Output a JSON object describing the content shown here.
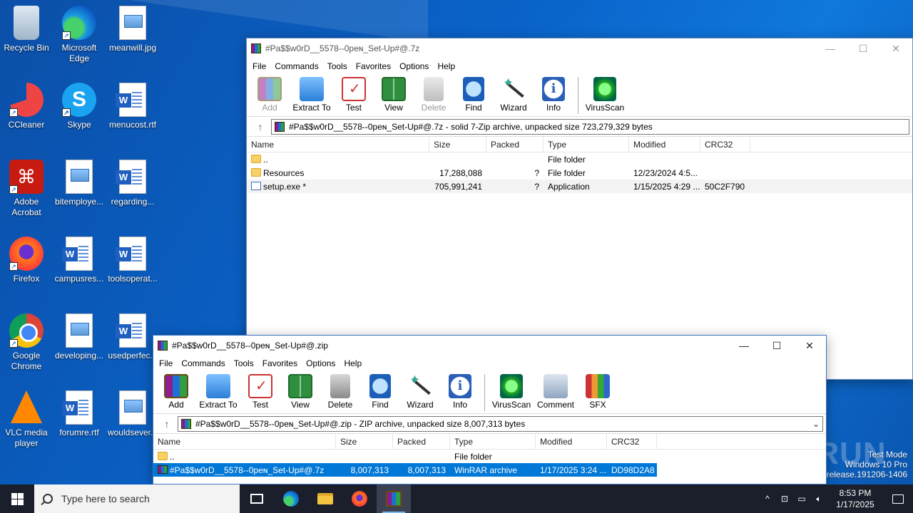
{
  "desktop": {
    "icons": [
      {
        "label": "Recycle Bin",
        "icon": "recycle-bin-icon"
      },
      {
        "label": "Microsoft Edge",
        "icon": "edge-icon"
      },
      {
        "label": "meanwill.jpg",
        "icon": "image-file-icon"
      },
      {
        "label": "CCleaner",
        "icon": "ccleaner-icon"
      },
      {
        "label": "Skype",
        "icon": "skype-icon"
      },
      {
        "label": "menucost.rtf",
        "icon": "word-doc-icon"
      },
      {
        "label": "Adobe Acrobat",
        "icon": "acrobat-icon"
      },
      {
        "label": "bitemploye...",
        "icon": "image-file-icon"
      },
      {
        "label": "regarding...",
        "icon": "word-doc-icon"
      },
      {
        "label": "Firefox",
        "icon": "firefox-icon"
      },
      {
        "label": "campusres...",
        "icon": "word-doc-icon"
      },
      {
        "label": "toolsoperat...",
        "icon": "word-doc-icon"
      },
      {
        "label": "Google Chrome",
        "icon": "chrome-icon"
      },
      {
        "label": "developing...",
        "icon": "image-file-icon"
      },
      {
        "label": "usedperfec...",
        "icon": "word-doc-icon"
      },
      {
        "label": "VLC media player",
        "icon": "vlc-icon"
      },
      {
        "label": "forumre.rtf",
        "icon": "word-doc-icon"
      },
      {
        "label": "wouldsever...",
        "icon": "image-file-icon"
      }
    ],
    "watermark": "ANY RUN",
    "os_info": {
      "line1": "Test Mode",
      "line2": "Windows 10 Pro",
      "line3": "b_release.191206-1406"
    }
  },
  "window_7z": {
    "title": "#Pa$$w0rD__5578--0peɴ_Set-Up#@.7z",
    "menu": [
      "File",
      "Commands",
      "Tools",
      "Favorites",
      "Options",
      "Help"
    ],
    "toolbar": [
      {
        "label": "Add",
        "icon": "add-archive-icon",
        "disabled": true
      },
      {
        "label": "Extract To",
        "icon": "extract-to-icon"
      },
      {
        "label": "Test",
        "icon": "test-icon"
      },
      {
        "label": "View",
        "icon": "view-icon"
      },
      {
        "label": "Delete",
        "icon": "delete-icon",
        "disabled": true
      },
      {
        "label": "Find",
        "icon": "find-icon"
      },
      {
        "label": "Wizard",
        "icon": "wizard-icon"
      },
      {
        "label": "Info",
        "icon": "info-icon"
      },
      {
        "label": "VirusScan",
        "icon": "virusscan-icon"
      }
    ],
    "address": "#Pa$$w0rD__5578--0peɴ_Set-Up#@.7z - solid 7-Zip archive, unpacked size 723,279,329 bytes",
    "columns": [
      "Name",
      "Size",
      "Packed",
      "Type",
      "Modified",
      "CRC32"
    ],
    "rows": [
      {
        "name": "..",
        "size": "",
        "packed": "",
        "type": "File folder",
        "modified": "",
        "crc": "",
        "kind": "folder"
      },
      {
        "name": "Resources",
        "size": "17,288,088",
        "packed": "?",
        "type": "File folder",
        "modified": "12/23/2024 4:5...",
        "crc": "",
        "kind": "folder"
      },
      {
        "name": "setup.exe *",
        "size": "705,991,241",
        "packed": "?",
        "type": "Application",
        "modified": "1/15/2025 4:29 ...",
        "crc": "50C2F790",
        "kind": "exe"
      }
    ]
  },
  "window_zip": {
    "title": "#Pa$$w0rD__5578--0peɴ_Set-Up#@.zip",
    "menu": [
      "File",
      "Commands",
      "Tools",
      "Favorites",
      "Options",
      "Help"
    ],
    "toolbar": [
      {
        "label": "Add",
        "icon": "add-archive-icon"
      },
      {
        "label": "Extract To",
        "icon": "extract-to-icon"
      },
      {
        "label": "Test",
        "icon": "test-icon"
      },
      {
        "label": "View",
        "icon": "view-icon"
      },
      {
        "label": "Delete",
        "icon": "delete-icon"
      },
      {
        "label": "Find",
        "icon": "find-icon"
      },
      {
        "label": "Wizard",
        "icon": "wizard-icon"
      },
      {
        "label": "Info",
        "icon": "info-icon"
      },
      {
        "label": "VirusScan",
        "icon": "virusscan-icon"
      },
      {
        "label": "Comment",
        "icon": "comment-icon"
      },
      {
        "label": "SFX",
        "icon": "sfx-icon"
      }
    ],
    "address": "#Pa$$w0rD__5578--0peɴ_Set-Up#@.zip - ZIP archive, unpacked size 8,007,313 bytes",
    "columns": [
      "Name",
      "Size",
      "Packed",
      "Type",
      "Modified",
      "CRC32"
    ],
    "rows": [
      {
        "name": "..",
        "size": "",
        "packed": "",
        "type": "File folder",
        "modified": "",
        "crc": "",
        "kind": "folder"
      },
      {
        "name": "#Pa$$w0rD__5578--0peɴ_Set-Up#@.7z",
        "size": "8,007,313",
        "packed": "8,007,313",
        "type": "WinRAR archive",
        "modified": "1/17/2025 3:24 ...",
        "crc": "DD98D2A8",
        "kind": "rar"
      }
    ]
  },
  "taskbar": {
    "search_placeholder": "Type here to search",
    "time": "8:53 PM",
    "date": "1/17/2025"
  }
}
